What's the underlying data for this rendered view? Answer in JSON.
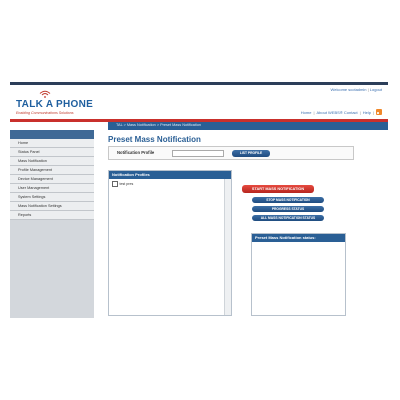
{
  "header": {
    "brand": "TALK A PHONE",
    "tagline": "Enabling Communications Solutions",
    "welcome": "Welcome scotadmin",
    "logout": "Logout",
    "links": [
      "Home",
      "About WEBS® Contact",
      "Help"
    ],
    "rss_icon": "rss-icon"
  },
  "breadcrumb": "TAL > Mass Notification > Preset Mass Notification",
  "sidebar": {
    "items": [
      {
        "label": "Home"
      },
      {
        "label": "Status Panel"
      },
      {
        "label": "Mass Notification"
      },
      {
        "label": "Profile Management"
      },
      {
        "label": "Device Management"
      },
      {
        "label": "User Management"
      },
      {
        "label": "System Settings"
      },
      {
        "label": "Mass Notification Settings"
      },
      {
        "label": "Reports"
      }
    ]
  },
  "main": {
    "title": "Preset Mass Notification",
    "profile_label": "Notification Profile",
    "profile_value": "",
    "list_profile_button": "LIST PROFILE",
    "profiles_panel_title": "Notification Profiles",
    "profiles": [
      {
        "label": "test pres"
      }
    ],
    "buttons": {
      "start": "START MASS NOTIFICATION",
      "stop": "STOP MASS NOTIFICATION",
      "progress": "PROGRESS STATUS",
      "all_status": "ALL MASS NOTIFICATION STATUS"
    },
    "status_panel_title": "Preset Mass Notification status:"
  },
  "colors": {
    "accent": "#2a5f95",
    "danger": "#c9302c",
    "header_dark": "#2c3e59"
  }
}
